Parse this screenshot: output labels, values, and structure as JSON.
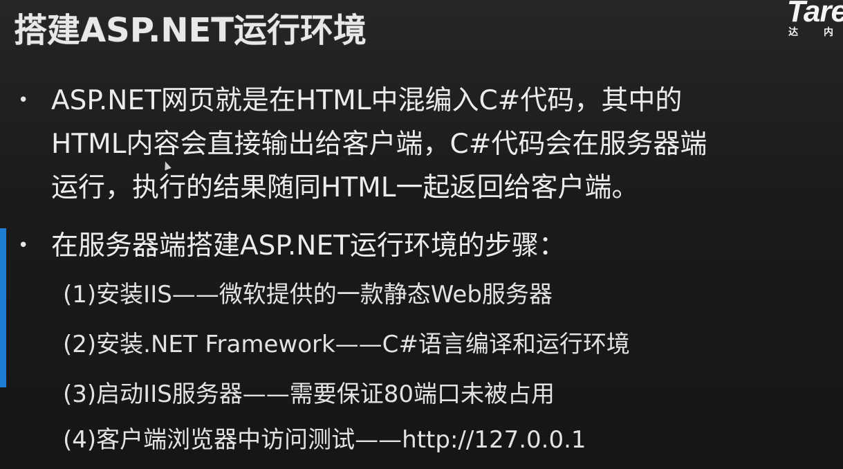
{
  "slide": {
    "title": "搭建ASP.NET运行环境",
    "logo": {
      "word": "Tare",
      "sub": "达 内"
    },
    "bullets": [
      {
        "lines": [
          "ASP.NET网页就是在HTML中混编入C#代码，其中的",
          "HTML内容会直接输出给客户端，C#代码会在服务器端",
          "运行，执行的结果随同HTML一起返回给客户端。"
        ]
      },
      {
        "lines": [
          "在服务器端搭建ASP.NET运行环境的步骤："
        ]
      }
    ],
    "steps": [
      "(1)安装IIS——微软提供的一款静态Web服务器",
      "(2)安装.NET Framework——C#语言编译和运行环境",
      "(3)启动IIS服务器——需要保证80端口未被占用",
      "(4)客户端浏览器中访问测试——http://127.0.0.1"
    ],
    "bullet_symbol": "•",
    "colors": {
      "background": "#1b1b1b",
      "text": "#ececec",
      "accent": "#1e7ed6"
    }
  }
}
